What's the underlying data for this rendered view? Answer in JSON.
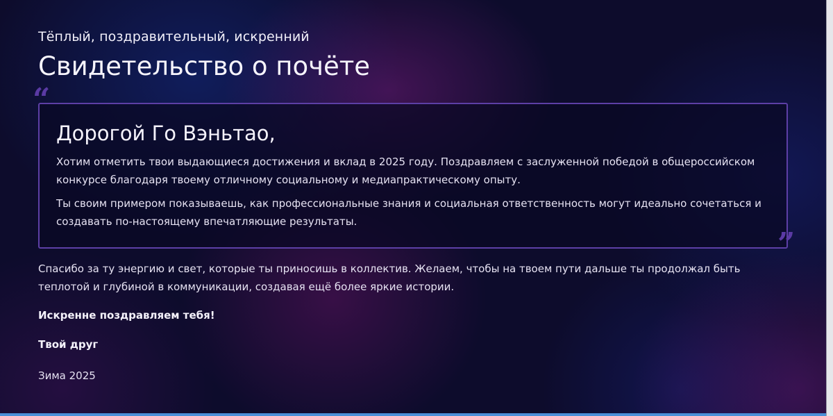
{
  "header": {
    "subtitle": "Тёплый, поздравительный, искренний",
    "title": "Свидетельство о почёте"
  },
  "quote": {
    "open_mark": "“",
    "close_mark": "”",
    "greeting": "Дорогой Го Вэньтао,",
    "paragraphs": [
      "Хотим отметить твои выдающиеся достижения и вклад в 2025 году. Поздравляем с заслуженной победой в общероссийском конкурсе благодаря твоему отличному социальному и медиапрактическому опыту.",
      "Ты своим примером показываешь, как профессиональные знания и социальная ответственность могут идеально сочетаться и создавать по-настоящему впечатляющие результаты."
    ]
  },
  "body": {
    "paragraph": "Спасибо за ту энергию и свет, которые ты приносишь в коллектив. Желаем, чтобы на твоем пути дальше ты продолжал быть теплотой и глубиной в коммуникации, создавая ещё более яркие истории.",
    "wishes": "Искренне поздравляем тебя!",
    "signature": "Твой друг",
    "date": "Зима 2025"
  },
  "colors": {
    "background": "#0d0c2c",
    "card_border": "#5d3fa6",
    "quote_mark": "#5a3aa4",
    "text": "#ece8f6"
  }
}
